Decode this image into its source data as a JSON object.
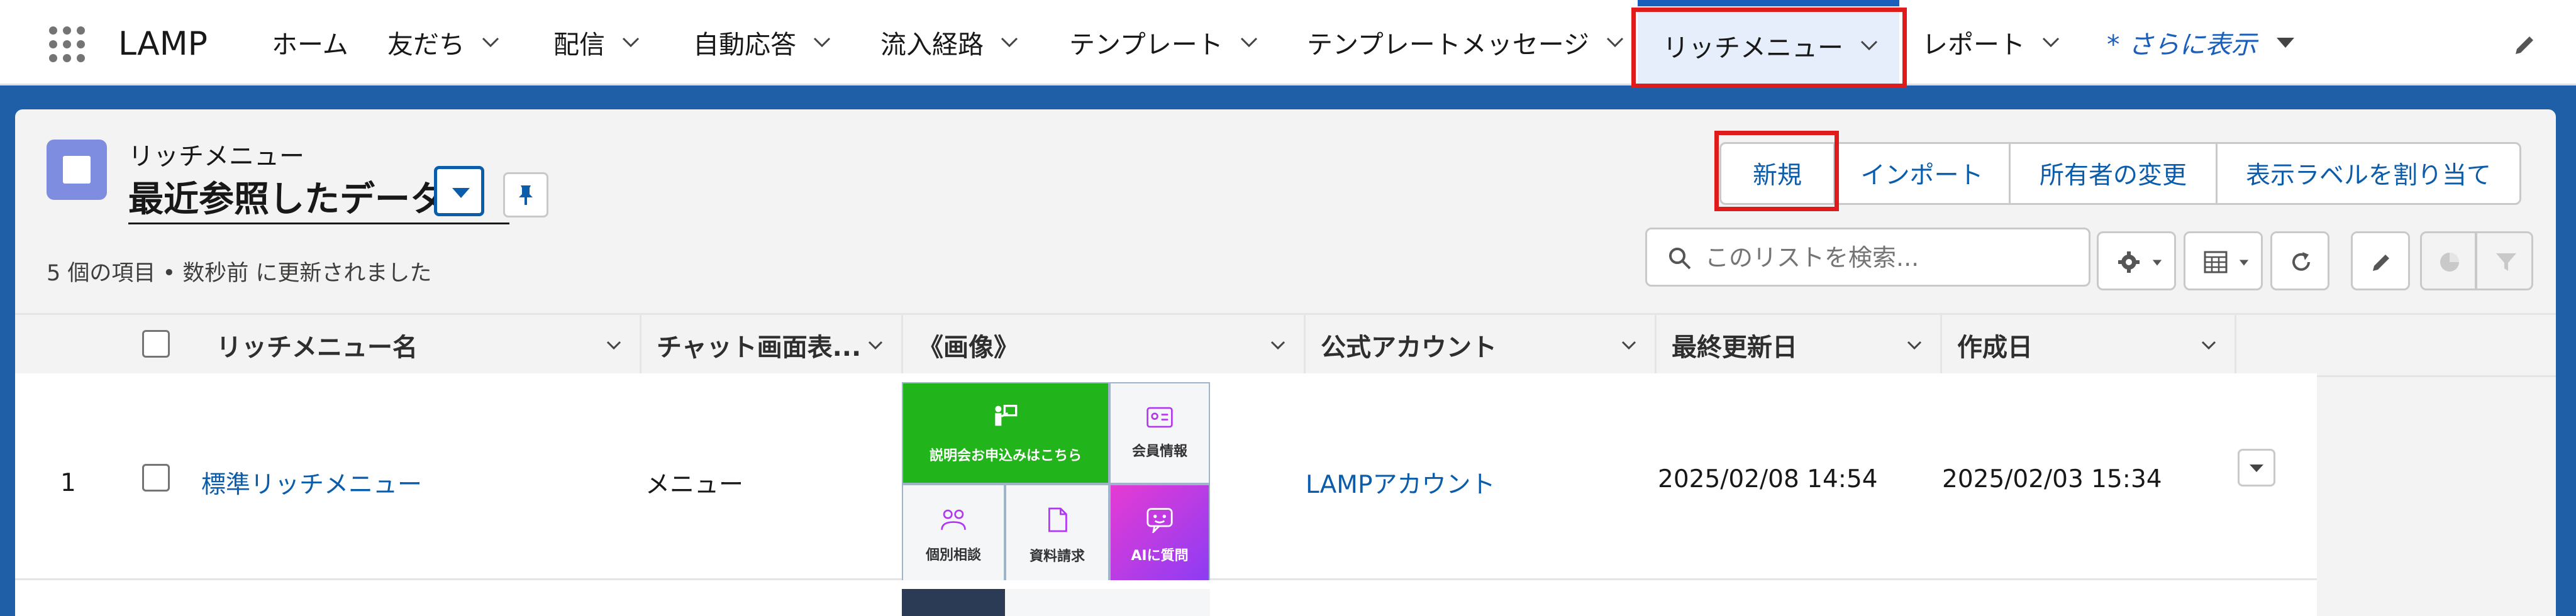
{
  "app": {
    "name": "LAMP"
  },
  "nav": {
    "items": [
      {
        "label": "ホーム"
      },
      {
        "label": "友だち"
      },
      {
        "label": "配信"
      },
      {
        "label": "自動応答"
      },
      {
        "label": "流入経路"
      },
      {
        "label": "テンプレート"
      },
      {
        "label": "テンプレートメッセージ"
      },
      {
        "label": "リッチメニュー",
        "active": true
      },
      {
        "label": "レポート"
      }
    ],
    "more_label": "* さらに表示"
  },
  "header": {
    "object_label": "リッチメニュー",
    "list_view_name": "最近参照したデータ",
    "meta": "5 個の項目 • 数秒前 に更新されました"
  },
  "actions": {
    "new": "新規",
    "import": "インポート",
    "change_owner": "所有者の変更",
    "assign_label": "表示ラベルを割り当て"
  },
  "search": {
    "placeholder": "このリストを検索...",
    "value": ""
  },
  "table": {
    "columns": [
      "リッチメニュー名",
      "チャット画面表...",
      "《画像》",
      "公式アカウント",
      "最終更新日",
      "作成日"
    ],
    "rows": [
      {
        "number": "1",
        "name": "標準リッチメニュー",
        "chat_display": "メニュー",
        "account": "LAMPアカウント",
        "last_modified": "2025/02/08 14:54",
        "created": "2025/02/03 15:34",
        "image_tiles": {
          "briefing": "説明会お申込みはこちら",
          "member": "会員情報",
          "consult": "個別相談",
          "docs": "資料請求",
          "ai": "AIに質問"
        }
      }
    ]
  },
  "colors": {
    "accent": "#0b5cab",
    "highlight": "#e01b1b",
    "tile_green": "#22b51b",
    "tile_purple": "#b236f0"
  }
}
